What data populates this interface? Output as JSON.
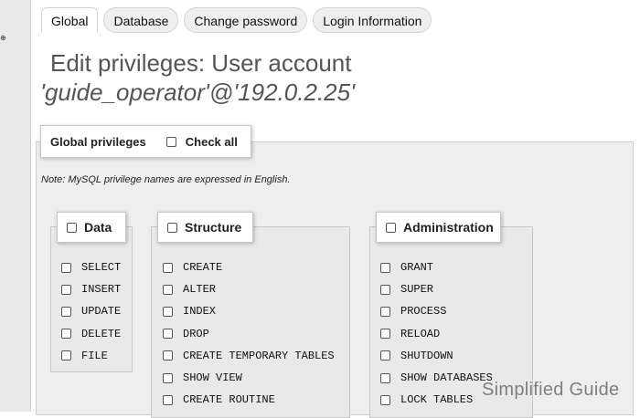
{
  "tabs": [
    "Global",
    "Database",
    "Change password",
    "Login Information"
  ],
  "title": {
    "line1": "Edit privileges: User account",
    "line2": "'guide_operator'@'192.0.2.25'"
  },
  "global_privileges": {
    "legend": "Global privileges",
    "check_all": "Check all",
    "note": "Note: MySQL privilege names are expressed in English."
  },
  "groups": {
    "data": {
      "label": "Data",
      "items": [
        "SELECT",
        "INSERT",
        "UPDATE",
        "DELETE",
        "FILE"
      ]
    },
    "structure": {
      "label": "Structure",
      "items": [
        "CREATE",
        "ALTER",
        "INDEX",
        "DROP",
        "CREATE TEMPORARY TABLES",
        "SHOW VIEW",
        "CREATE ROUTINE"
      ]
    },
    "administration": {
      "label": "Administration",
      "items": [
        "GRANT",
        "SUPER",
        "PROCESS",
        "RELOAD",
        "SHUTDOWN",
        "SHOW DATABASES",
        "LOCK TABLES"
      ]
    }
  },
  "watermark": "Simplified Guide"
}
